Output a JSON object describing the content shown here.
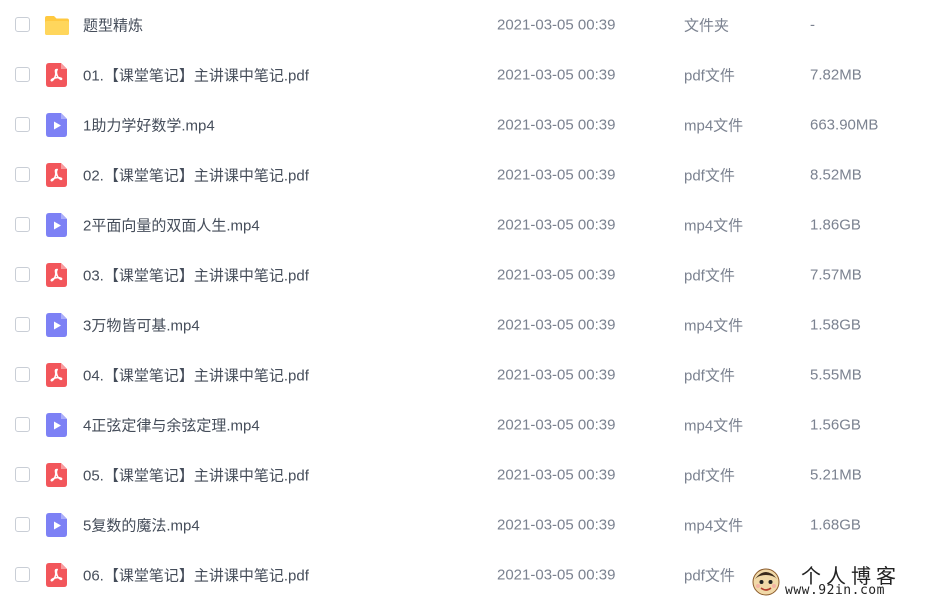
{
  "file_list": {
    "rows": [
      {
        "name": "题型精炼",
        "modified": "2021-03-05 00:39",
        "type": "文件夹",
        "size": "-",
        "icon": "folder-icon"
      },
      {
        "name": "01.【课堂笔记】主讲课中笔记.pdf",
        "modified": "2021-03-05 00:39",
        "type": "pdf文件",
        "size": "7.82MB",
        "icon": "pdf-icon"
      },
      {
        "name": "1助力学好数学.mp4",
        "modified": "2021-03-05 00:39",
        "type": "mp4文件",
        "size": "663.90MB",
        "icon": "video-icon"
      },
      {
        "name": "02.【课堂笔记】主讲课中笔记.pdf",
        "modified": "2021-03-05 00:39",
        "type": "pdf文件",
        "size": "8.52MB",
        "icon": "pdf-icon"
      },
      {
        "name": "2平面向量的双面人生.mp4",
        "modified": "2021-03-05 00:39",
        "type": "mp4文件",
        "size": "1.86GB",
        "icon": "video-icon"
      },
      {
        "name": "03.【课堂笔记】主讲课中笔记.pdf",
        "modified": "2021-03-05 00:39",
        "type": "pdf文件",
        "size": "7.57MB",
        "icon": "pdf-icon"
      },
      {
        "name": "3万物皆可基.mp4",
        "modified": "2021-03-05 00:39",
        "type": "mp4文件",
        "size": "1.58GB",
        "icon": "video-icon"
      },
      {
        "name": "04.【课堂笔记】主讲课中笔记.pdf",
        "modified": "2021-03-05 00:39",
        "type": "pdf文件",
        "size": "5.55MB",
        "icon": "pdf-icon"
      },
      {
        "name": "4正弦定律与余弦定理.mp4",
        "modified": "2021-03-05 00:39",
        "type": "mp4文件",
        "size": "1.56GB",
        "icon": "video-icon"
      },
      {
        "name": "05.【课堂笔记】主讲课中笔记.pdf",
        "modified": "2021-03-05 00:39",
        "type": "pdf文件",
        "size": "5.21MB",
        "icon": "pdf-icon"
      },
      {
        "name": "5复数的魔法.mp4",
        "modified": "2021-03-05 00:39",
        "type": "mp4文件",
        "size": "1.68GB",
        "icon": "video-icon"
      },
      {
        "name": "06.【课堂笔记】主讲课中笔记.pdf",
        "modified": "2021-03-05 00:39",
        "type": "pdf文件",
        "size": "",
        "icon": "pdf-icon"
      }
    ]
  },
  "watermark": {
    "title": "个人博客",
    "url": "www.92in.com"
  },
  "colors": {
    "folder": "#ffc940",
    "pdf": "#f2565b",
    "video": "#7d81f5",
    "text_primary": "#454d5a",
    "text_secondary": "#7b8290"
  }
}
